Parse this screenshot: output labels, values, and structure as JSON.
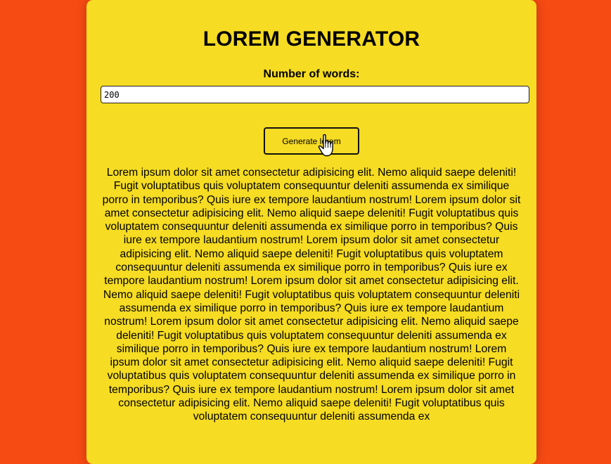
{
  "app": {
    "title": "LOREM GENERATOR"
  },
  "form": {
    "label": "Number of words:",
    "word_count": "200",
    "generate_label": "Generate lorem"
  },
  "output": {
    "text": "Lorem ipsum dolor sit amet consectetur adipisicing elit. Nemo aliquid saepe deleniti! Fugit voluptatibus quis voluptatem consequuntur deleniti assumenda ex similique porro in temporibus? Quis iure ex tempore laudantium nostrum! Lorem ipsum dolor sit amet consectetur adipisicing elit. Nemo aliquid saepe deleniti! Fugit voluptatibus quis voluptatem consequuntur deleniti assumenda ex similique porro in temporibus? Quis iure ex tempore laudantium nostrum! Lorem ipsum dolor sit amet consectetur adipisicing elit. Nemo aliquid saepe deleniti! Fugit voluptatibus quis voluptatem consequuntur deleniti assumenda ex similique porro in temporibus? Quis iure ex tempore laudantium nostrum! Lorem ipsum dolor sit amet consectetur adipisicing elit. Nemo aliquid saepe deleniti! Fugit voluptatibus quis voluptatem consequuntur deleniti assumenda ex similique porro in temporibus? Quis iure ex tempore laudantium nostrum! Lorem ipsum dolor sit amet consectetur adipisicing elit. Nemo aliquid saepe deleniti! Fugit voluptatibus quis voluptatem consequuntur deleniti assumenda ex similique porro in temporibus? Quis iure ex tempore laudantium nostrum! Lorem ipsum dolor sit amet consectetur adipisicing elit. Nemo aliquid saepe deleniti! Fugit voluptatibus quis voluptatem consequuntur deleniti assumenda ex similique porro in temporibus? Quis iure ex tempore laudantium nostrum! Lorem ipsum dolor sit amet consectetur adipisicing elit. Nemo aliquid saepe deleniti! Fugit voluptatibus quis voluptatem consequuntur deleniti assumenda ex"
  },
  "theme": {
    "background": "#f74b14",
    "card": "#f6dc22"
  },
  "icons": {
    "cursor": "hand-pointer-icon"
  }
}
